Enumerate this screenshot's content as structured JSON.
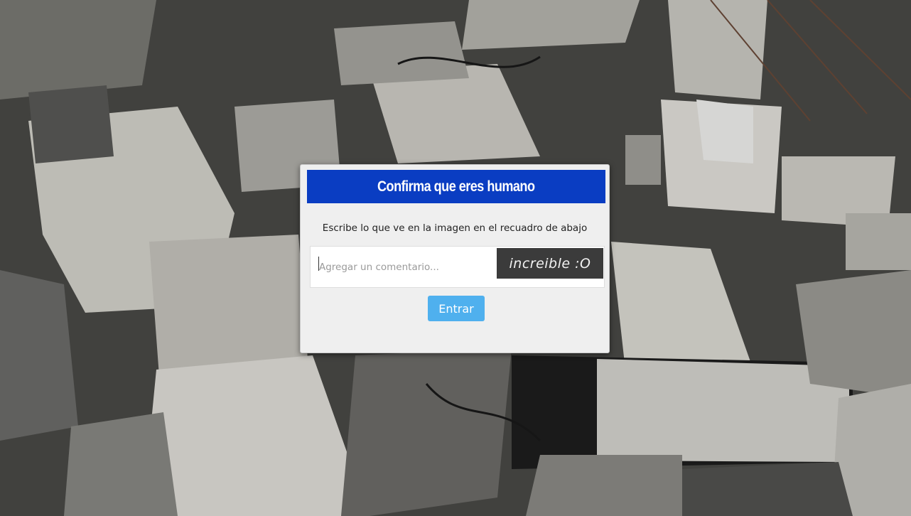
{
  "dialog": {
    "title": "Confirma que eres humano",
    "instructions": "Escribe lo que ve en la imagen en el recuadro de abajo",
    "input_placeholder": "Agregar un comentario...",
    "input_value": "",
    "captcha_text": "increible :O",
    "submit_label": "Entrar"
  },
  "colors": {
    "header_bg": "#0a3dc2",
    "button_bg": "#4fb0ee",
    "captcha_bg": "#3b3b3b"
  }
}
